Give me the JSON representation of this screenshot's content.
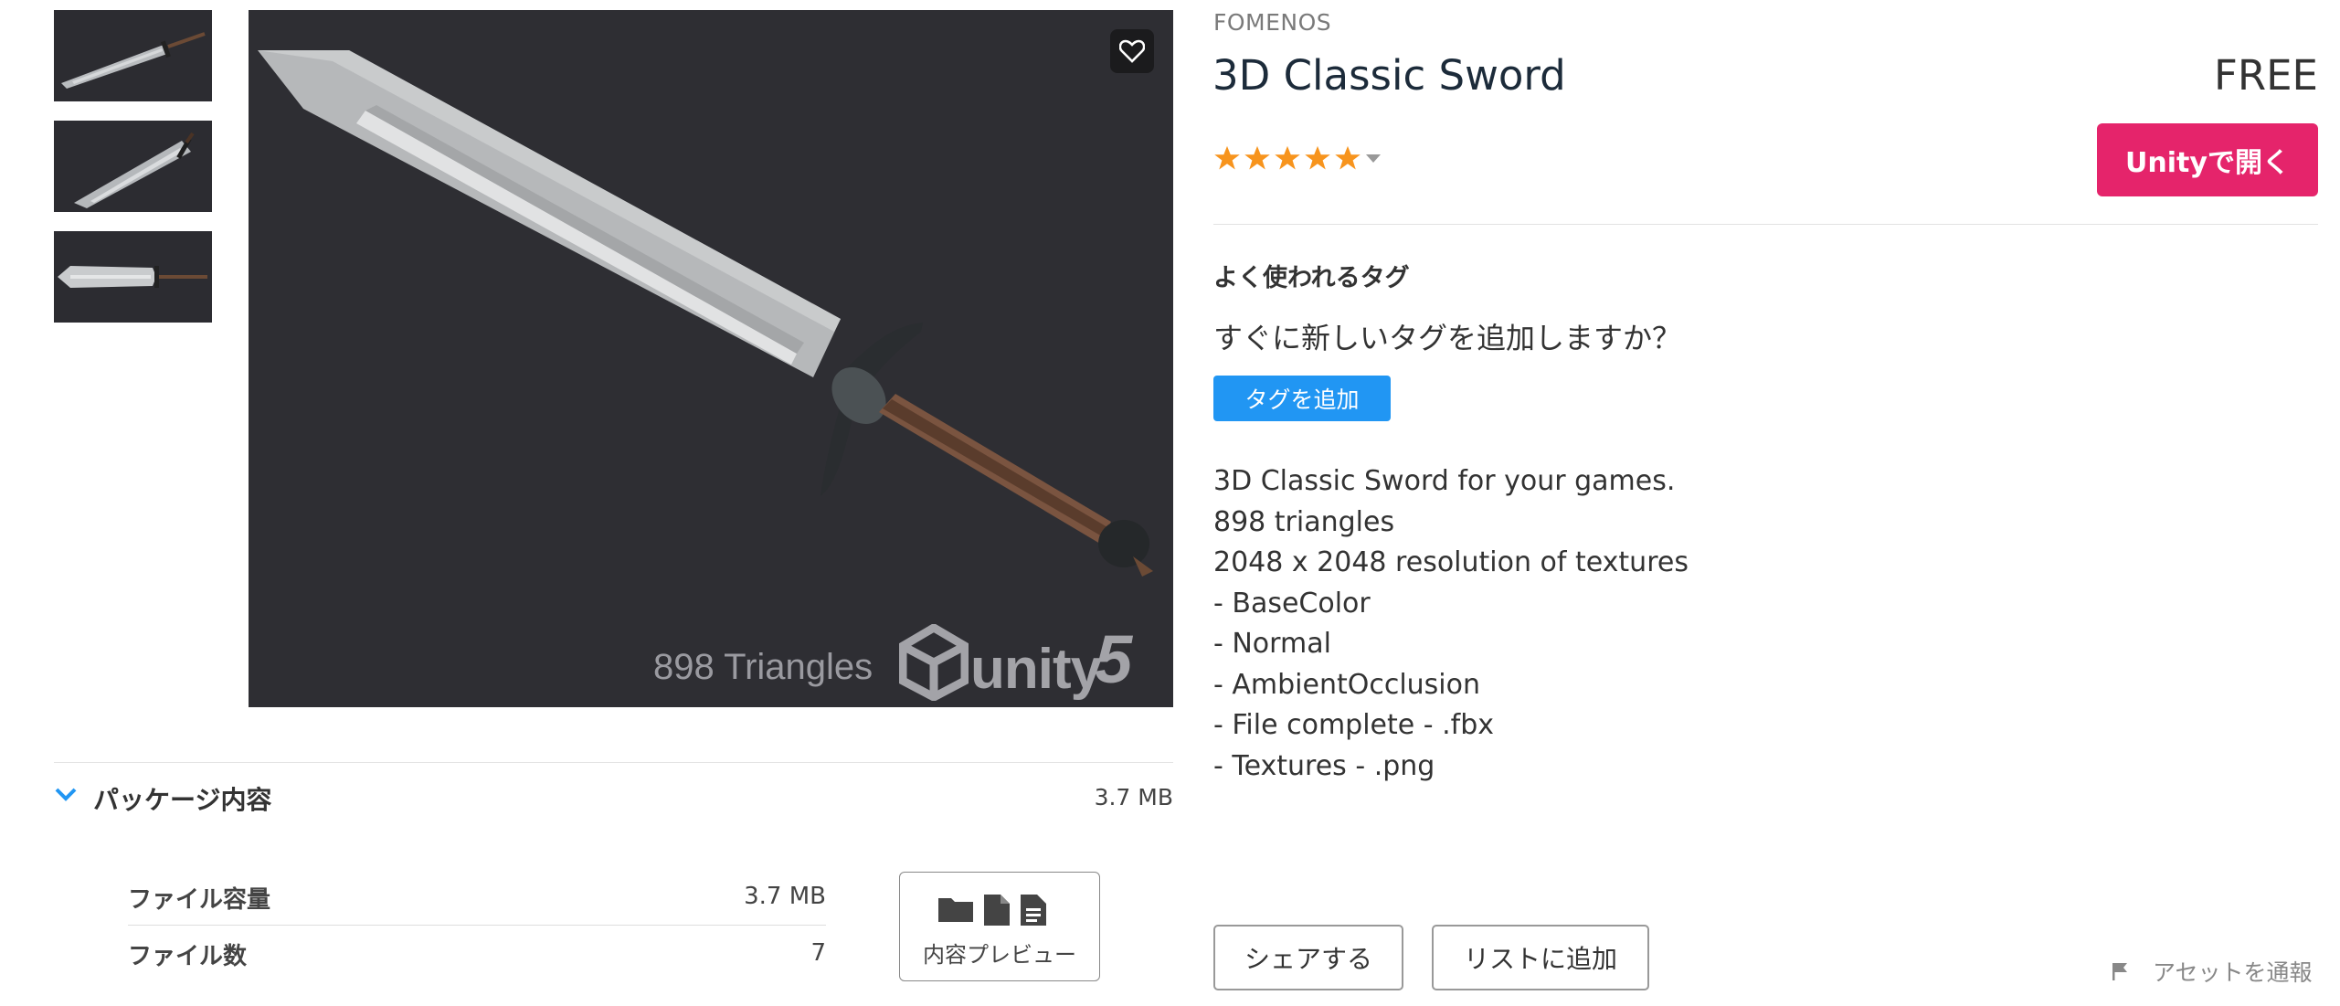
{
  "gallery": {
    "overlay_triangles": "898 Triangles",
    "overlay_logo_text": "unity",
    "overlay_logo_version": "5"
  },
  "package": {
    "title": "パッケージ内容",
    "size": "3.7 MB",
    "rows": [
      {
        "label": "ファイル容量",
        "value": "3.7 MB"
      },
      {
        "label": "ファイル数",
        "value": "7"
      }
    ],
    "preview_label": "内容プレビュー"
  },
  "product": {
    "publisher": "FOMENOS",
    "title": "3D Classic Sword",
    "price": "FREE",
    "rating": 5,
    "open_button": "Unityで開く"
  },
  "tags": {
    "heading": "よく使われるタグ",
    "prompt": "すぐに新しいタグを追加しますか？",
    "add_button": "タグを追加"
  },
  "description": {
    "lines": [
      "3D Classic Sword for your games.",
      "898 triangles",
      "2048 x 2048 resolution of textures",
      "- BaseColor",
      "- Normal",
      "- AmbientOcclusion",
      "- File complete - .fbx",
      "- Textures - .png"
    ]
  },
  "actions": {
    "share": "シェアする",
    "add_to_list": "リストに追加",
    "report": "アセットを通報"
  },
  "colors": {
    "accent_pink": "#e5246b",
    "accent_blue": "#2196f3",
    "star": "#f7941d"
  }
}
